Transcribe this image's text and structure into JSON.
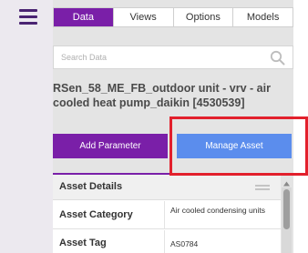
{
  "tabs": [
    {
      "label": "Data",
      "active": true
    },
    {
      "label": "Views",
      "active": false
    },
    {
      "label": "Options",
      "active": false
    },
    {
      "label": "Models",
      "active": false
    }
  ],
  "search": {
    "placeholder": "Search Data",
    "value": ""
  },
  "asset": {
    "title": "RSen_58_ME_FB_outdoor unit - vrv - air cooled heat pump_daikin [4530539]"
  },
  "buttons": {
    "add_parameter": "Add Parameter",
    "manage_asset": "Manage Asset"
  },
  "details": {
    "title": "Asset Details",
    "rows": [
      {
        "label": "Asset Category",
        "value": "Air cooled condensing units"
      },
      {
        "label": "Asset Tag",
        "value": "AS0784"
      }
    ]
  },
  "colors": {
    "accent_purple": "#7a1fa8",
    "button_blue": "#5b8ded",
    "highlight_red": "#e2202c",
    "menu_icon": "#4a2472"
  },
  "icons": {
    "menu": "hamburger-menu-icon",
    "search": "search-icon",
    "drag": "drag-handle-icon"
  }
}
